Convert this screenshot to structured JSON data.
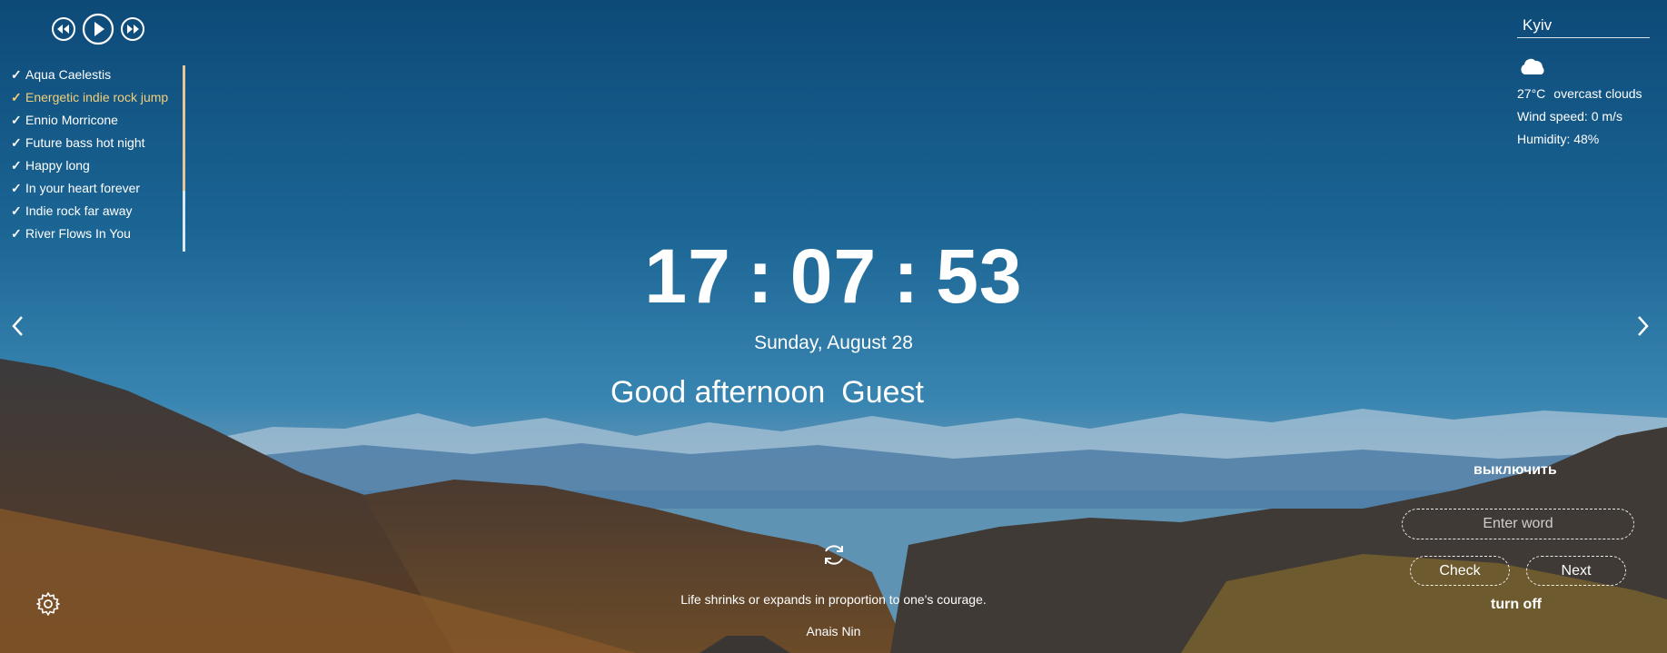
{
  "player": {
    "prev_icon": "rewind-icon",
    "play_icon": "play-icon",
    "next_icon": "fast-forward-icon",
    "playlist": [
      {
        "title": "Aqua Caelestis",
        "active": false
      },
      {
        "title": "Energetic indie rock jump",
        "active": true
      },
      {
        "title": "Ennio Morricone",
        "active": false
      },
      {
        "title": "Future bass hot night",
        "active": false
      },
      {
        "title": "Happy long",
        "active": false
      },
      {
        "title": "In your heart forever",
        "active": false
      },
      {
        "title": "Indie rock far away",
        "active": false
      },
      {
        "title": "River Flows In You",
        "active": false
      }
    ],
    "check_mark": "✓",
    "active_color": "#f3cf7a"
  },
  "weather": {
    "city": "Kyiv",
    "icon": "cloud-icon",
    "temperature": "27°C",
    "description": "overcast clouds",
    "wind": "Wind speed: 0 m/s",
    "humidity": "Humidity: 48%"
  },
  "clock": {
    "hours": "17",
    "minutes": "07",
    "seconds": "53",
    "separator": ":"
  },
  "date": "Sunday, August 28",
  "greeting": {
    "text": "Good afternoon",
    "name": "Guest"
  },
  "quote": {
    "refresh_icon": "refresh-icon",
    "text": "Life shrinks or expands in proportion to one's courage.",
    "author": "Anais Nin"
  },
  "slider": {
    "prev_icon": "chevron-left-icon",
    "next_icon": "chevron-right-icon"
  },
  "settings": {
    "icon": "gear-icon"
  },
  "word_game": {
    "off_label": "выключить",
    "input_placeholder": "Enter word",
    "check_label": "Check",
    "next_label": "Next",
    "turn_off_label": "turn off"
  }
}
